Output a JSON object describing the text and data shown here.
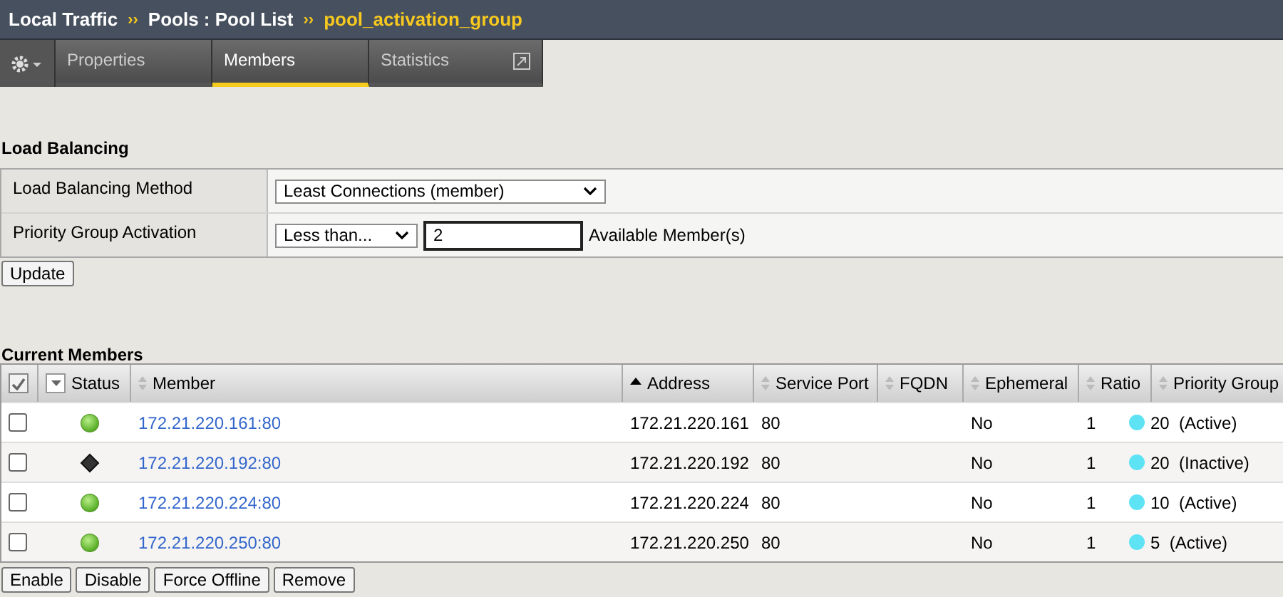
{
  "breadcrumb": {
    "parts": [
      "Local Traffic",
      "Pools : Pool List"
    ],
    "separator": "››",
    "current": "pool_activation_group"
  },
  "tabs": [
    {
      "label": "Properties",
      "selected": false
    },
    {
      "label": "Members",
      "selected": true
    },
    {
      "label": "Statistics",
      "selected": false
    }
  ],
  "load_balancing": {
    "title": "Load Balancing",
    "method": {
      "label": "Load Balancing Method",
      "value": "Least Connections (member)"
    },
    "priority": {
      "label": "Priority Group Activation",
      "value": "Less than...",
      "count": "2",
      "suffix": "Available Member(s)"
    },
    "button": "Update"
  },
  "members": {
    "title": "Current Members",
    "select_all": {
      "checked": true
    },
    "columns": [
      {
        "label": "Status",
        "sortable": false
      },
      {
        "label": "Member",
        "sortable": true,
        "sorted": false
      },
      {
        "label": "Address",
        "sortable": true,
        "sorted": true
      },
      {
        "label": "Service Port",
        "sortable": true,
        "sorted": false
      },
      {
        "label": "FQDN",
        "sortable": true,
        "sorted": false
      },
      {
        "label": "Ephemeral",
        "sortable": true,
        "sorted": false
      },
      {
        "label": "Ratio",
        "sortable": true,
        "sorted": false
      },
      {
        "label": "Priority Group",
        "sortable": true,
        "sorted": false
      }
    ],
    "rows": [
      {
        "checked": false,
        "status": {
          "kind": "available"
        },
        "member": "172.21.220.161:80",
        "address": "172.21.220.161",
        "port": "80",
        "ephemeral": "No",
        "ratio": "1",
        "priority": "20  (Active)"
      },
      {
        "checked": false,
        "status": {
          "kind": "unknown"
        },
        "member": "172.21.220.192:80",
        "address": "172.21.220.192",
        "port": "80",
        "ephemeral": "No",
        "ratio": "1",
        "priority": "20  (Inactive)"
      },
      {
        "checked": false,
        "status": {
          "kind": "available"
        },
        "member": "172.21.220.224:80",
        "address": "172.21.220.224",
        "port": "80",
        "ephemeral": "No",
        "ratio": "1",
        "priority": "10  (Active)"
      },
      {
        "checked": false,
        "status": {
          "kind": "available"
        },
        "member": "172.21.220.250:80",
        "address": "172.21.220.250",
        "port": "80",
        "ephemeral": "No",
        "ratio": "1",
        "priority": "5  (Active)"
      }
    ],
    "buttons": [
      "Enable",
      "Disable",
      "Force Offline",
      "Remove"
    ]
  }
}
